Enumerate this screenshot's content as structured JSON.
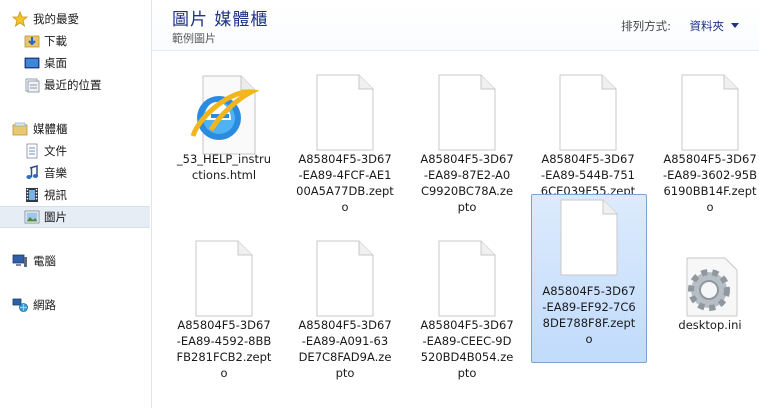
{
  "sidebar": {
    "favorites_label": "我的最愛",
    "favorites": [
      {
        "label": "下載",
        "icon": "downloads-folder-icon"
      },
      {
        "label": "桌面",
        "icon": "desktop-icon"
      },
      {
        "label": "最近的位置",
        "icon": "recent-places-icon"
      }
    ],
    "libraries_label": "媒體櫃",
    "libraries": [
      {
        "label": "文件",
        "icon": "documents-icon"
      },
      {
        "label": "音樂",
        "icon": "music-icon"
      },
      {
        "label": "視訊",
        "icon": "videos-icon"
      },
      {
        "label": "圖片",
        "icon": "pictures-icon",
        "selected": true
      }
    ],
    "computer_label": "電腦",
    "network_label": "網路"
  },
  "header": {
    "title": "圖片 媒體櫃",
    "subtitle": "範例圖片",
    "arrange_label": "排列方式:",
    "arrange_value": "資料夾"
  },
  "files": [
    {
      "name": "_53_HELP_instructions.html",
      "lines": [
        "_53_HELP_instru",
        "ctions.html"
      ],
      "type": "html"
    },
    {
      "name": "A85804F5-3D67-EA89-4FCF-AE100A5A77DB.zepto",
      "lines": [
        "A85804F5-3D67",
        "-EA89-4FCF-AE1",
        "00A5A77DB.zept",
        "o"
      ],
      "type": "blank"
    },
    {
      "name": "A85804F5-3D67-EA89-87E2-A0C9920BC78A.zepto",
      "lines": [
        "A85804F5-3D67",
        "-EA89-87E2-A0",
        "C9920BC78A.ze",
        "pto"
      ],
      "type": "blank"
    },
    {
      "name": "A85804F5-3D67-EA89-544B-7516CE039F55.zepto",
      "lines": [
        "A85804F5-3D67",
        "-EA89-544B-751",
        "6CE039F55.zept",
        "o"
      ],
      "type": "blank"
    },
    {
      "name": "A85804F5-3D67-EA89-3602-95B6190BB14F.zepto",
      "lines": [
        "A85804F5-3D67",
        "-EA89-3602-95B",
        "6190BB14F.zept",
        "o"
      ],
      "type": "blank"
    },
    {
      "name": "A85804F5-3D67-EA89-4592-8BBFB281FCB2.zepto",
      "lines": [
        "A85804F5-3D67",
        "-EA89-4592-8BB",
        "FB281FCB2.zept",
        "o"
      ],
      "type": "blank"
    },
    {
      "name": "A85804F5-3D67-EA89-A091-63DE7C8FAD9A.zepto",
      "lines": [
        "A85804F5-3D67",
        "-EA89-A091-63",
        "DE7C8FAD9A.ze",
        "pto"
      ],
      "type": "blank"
    },
    {
      "name": "A85804F5-3D67-EA89-CEEC-9D520BD4B054.zepto",
      "lines": [
        "A85804F5-3D67",
        "-EA89-CEEC-9D",
        "520BD4B054.ze",
        "pto"
      ],
      "type": "blank"
    },
    {
      "name": "A85804F5-3D67-EA89-EF92-7C68DE788F8F.zepto",
      "lines": [
        "A85804F5-3D67",
        "-EA89-EF92-7C6",
        "8DE788F8F.zept",
        "o"
      ],
      "type": "blank",
      "selected": true
    },
    {
      "name": "desktop.ini",
      "lines": [
        "desktop.ini"
      ],
      "type": "ini"
    }
  ]
}
